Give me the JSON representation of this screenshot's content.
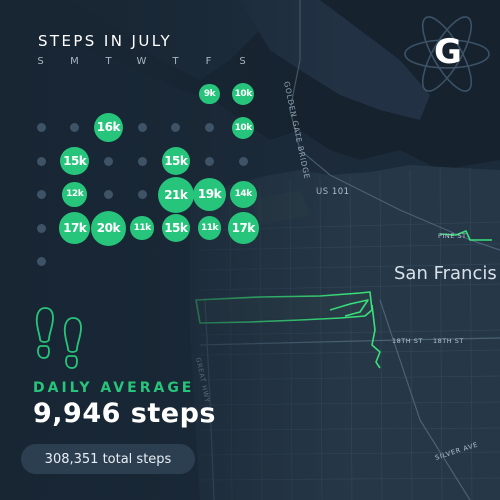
{
  "header": {
    "title": "STEPS IN JULY",
    "day_initials": [
      "S",
      "M",
      "T",
      "W",
      "T",
      "F",
      "S"
    ]
  },
  "calendar": {
    "accent_color": "#27c57b",
    "muted_color": "#2f8f5d",
    "empty_color": "#3e5466",
    "days": [
      {
        "day": 1,
        "label": "9k"
      },
      {
        "day": 2,
        "label": "10k"
      },
      {
        "day": 3,
        "label": ""
      },
      {
        "day": 4,
        "label": ""
      },
      {
        "day": 5,
        "label": "16k"
      },
      {
        "day": 6,
        "label": ""
      },
      {
        "day": 7,
        "label": ""
      },
      {
        "day": 8,
        "label": ""
      },
      {
        "day": 9,
        "label": "10k"
      },
      {
        "day": 10,
        "label": ""
      },
      {
        "day": 11,
        "label": "15k"
      },
      {
        "day": 12,
        "label": ""
      },
      {
        "day": 13,
        "label": ""
      },
      {
        "day": 14,
        "label": "15k"
      },
      {
        "day": 15,
        "label": ""
      },
      {
        "day": 16,
        "label": ""
      },
      {
        "day": 17,
        "label": ""
      },
      {
        "day": 18,
        "label": "12k"
      },
      {
        "day": 19,
        "label": ""
      },
      {
        "day": 20,
        "label": ""
      },
      {
        "day": 21,
        "label": "21k"
      },
      {
        "day": 22,
        "label": "19k"
      },
      {
        "day": 23,
        "label": "14k"
      },
      {
        "day": 24,
        "label": ""
      },
      {
        "day": 25,
        "label": "17k"
      },
      {
        "day": 26,
        "label": "20k"
      },
      {
        "day": 27,
        "label": "11k"
      },
      {
        "day": 28,
        "label": "15k"
      },
      {
        "day": 29,
        "label": "11k"
      },
      {
        "day": 30,
        "label": "17k"
      },
      {
        "day": 31,
        "label": ""
      }
    ]
  },
  "summary": {
    "average_label": "DAILY AVERAGE",
    "average_value": "9,946 steps",
    "total_label": "308,351 total steps"
  },
  "logo": {
    "letter": "G"
  },
  "map": {
    "labels": {
      "golden_gate_bridge": "GOLDEN GATE BRIDGE",
      "highway": "US 101",
      "city": "San Francis",
      "pine": "PINE ST",
      "street_18th": "18TH ST",
      "street_18th_b": "18TH ST",
      "great_hwy": "GREAT HWY",
      "silver": "SILVER AVE"
    },
    "route_color": "#39e07a"
  }
}
